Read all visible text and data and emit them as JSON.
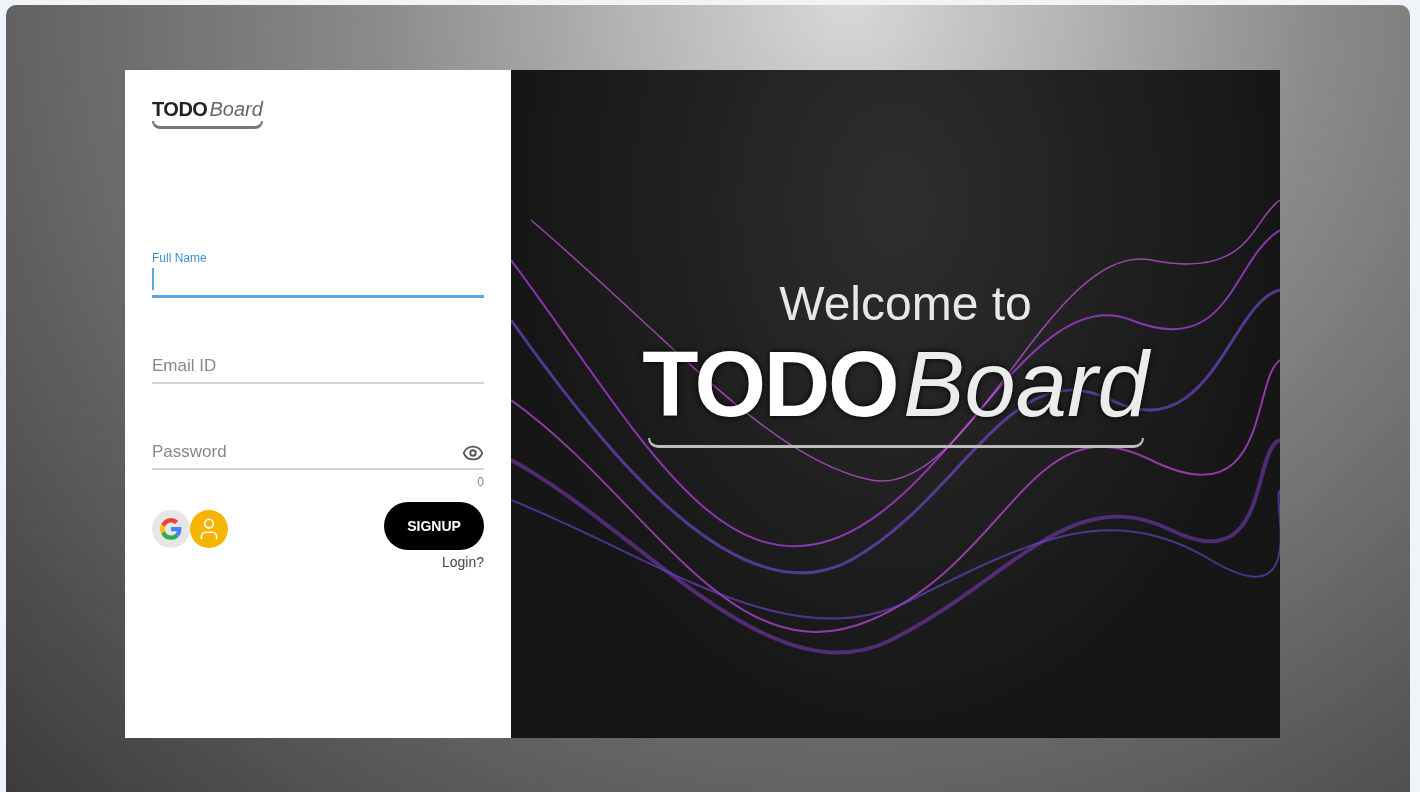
{
  "logo": {
    "bold": "TODO",
    "light": "Board"
  },
  "fields": [
    {
      "label": "Full Name",
      "kind": "text",
      "focused": true
    },
    {
      "placeholder": "Email ID",
      "kind": "text",
      "focused": false
    },
    {
      "placeholder": "Password",
      "kind": "password",
      "focused": false,
      "counter": "0"
    }
  ],
  "signup_button": "SIGNUP",
  "login_link": "Login?",
  "welcome": {
    "line": "Welcome to",
    "bold": "TODO",
    "light": "Board"
  }
}
